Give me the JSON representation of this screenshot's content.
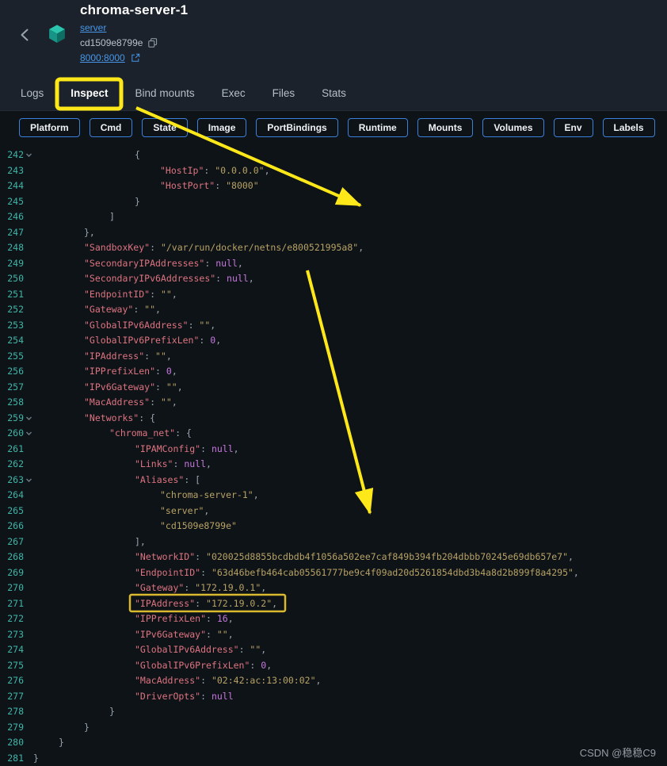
{
  "header": {
    "title": "chroma-server-1",
    "compose_link": "server",
    "container_id": "cd1509e8799e",
    "port_link": "8000:8000"
  },
  "tabs": {
    "items": [
      {
        "label": "Logs",
        "active": false
      },
      {
        "label": "Inspect",
        "active": true
      },
      {
        "label": "Bind mounts",
        "active": false
      },
      {
        "label": "Exec",
        "active": false
      },
      {
        "label": "Files",
        "active": false
      },
      {
        "label": "Stats",
        "active": false
      }
    ]
  },
  "section_chips": [
    "Platform",
    "Cmd",
    "State",
    "Image",
    "PortBindings",
    "Runtime",
    "Mounts",
    "Volumes",
    "Env",
    "Labels"
  ],
  "code": {
    "lines": [
      {
        "num": 242,
        "indent": 4,
        "fold": true,
        "tokens": [
          [
            "p",
            "{"
          ]
        ]
      },
      {
        "num": 243,
        "indent": 5,
        "fold": false,
        "tokens": [
          [
            "k",
            "\"HostIp\""
          ],
          [
            "p",
            ": "
          ],
          [
            "s",
            "\"0.0.0.0\""
          ],
          [
            "p",
            ","
          ]
        ]
      },
      {
        "num": 244,
        "indent": 5,
        "fold": false,
        "tokens": [
          [
            "k",
            "\"HostPort\""
          ],
          [
            "p",
            ": "
          ],
          [
            "s",
            "\"8000\""
          ]
        ]
      },
      {
        "num": 245,
        "indent": 4,
        "fold": false,
        "tokens": [
          [
            "p",
            "}"
          ]
        ]
      },
      {
        "num": 246,
        "indent": 3,
        "fold": false,
        "tokens": [
          [
            "p",
            "]"
          ]
        ]
      },
      {
        "num": 247,
        "indent": 2,
        "fold": false,
        "tokens": [
          [
            "p",
            "},"
          ]
        ]
      },
      {
        "num": 248,
        "indent": 2,
        "fold": false,
        "tokens": [
          [
            "k",
            "\"SandboxKey\""
          ],
          [
            "p",
            ": "
          ],
          [
            "s",
            "\"/var/run/docker/netns/e800521995a8\""
          ],
          [
            "p",
            ","
          ]
        ]
      },
      {
        "num": 249,
        "indent": 2,
        "fold": false,
        "tokens": [
          [
            "k",
            "\"SecondaryIPAddresses\""
          ],
          [
            "p",
            ": "
          ],
          [
            "n",
            "null"
          ],
          [
            "p",
            ","
          ]
        ]
      },
      {
        "num": 250,
        "indent": 2,
        "fold": false,
        "tokens": [
          [
            "k",
            "\"SecondaryIPv6Addresses\""
          ],
          [
            "p",
            ": "
          ],
          [
            "n",
            "null"
          ],
          [
            "p",
            ","
          ]
        ]
      },
      {
        "num": 251,
        "indent": 2,
        "fold": false,
        "tokens": [
          [
            "k",
            "\"EndpointID\""
          ],
          [
            "p",
            ": "
          ],
          [
            "s",
            "\"\""
          ],
          [
            "p",
            ","
          ]
        ]
      },
      {
        "num": 252,
        "indent": 2,
        "fold": false,
        "tokens": [
          [
            "k",
            "\"Gateway\""
          ],
          [
            "p",
            ": "
          ],
          [
            "s",
            "\"\""
          ],
          [
            "p",
            ","
          ]
        ]
      },
      {
        "num": 253,
        "indent": 2,
        "fold": false,
        "tokens": [
          [
            "k",
            "\"GlobalIPv6Address\""
          ],
          [
            "p",
            ": "
          ],
          [
            "s",
            "\"\""
          ],
          [
            "p",
            ","
          ]
        ]
      },
      {
        "num": 254,
        "indent": 2,
        "fold": false,
        "tokens": [
          [
            "k",
            "\"GlobalIPv6PrefixLen\""
          ],
          [
            "p",
            ": "
          ],
          [
            "n",
            "0"
          ],
          [
            "p",
            ","
          ]
        ]
      },
      {
        "num": 255,
        "indent": 2,
        "fold": false,
        "tokens": [
          [
            "k",
            "\"IPAddress\""
          ],
          [
            "p",
            ": "
          ],
          [
            "s",
            "\"\""
          ],
          [
            "p",
            ","
          ]
        ]
      },
      {
        "num": 256,
        "indent": 2,
        "fold": false,
        "tokens": [
          [
            "k",
            "\"IPPrefixLen\""
          ],
          [
            "p",
            ": "
          ],
          [
            "n",
            "0"
          ],
          [
            "p",
            ","
          ]
        ]
      },
      {
        "num": 257,
        "indent": 2,
        "fold": false,
        "tokens": [
          [
            "k",
            "\"IPv6Gateway\""
          ],
          [
            "p",
            ": "
          ],
          [
            "s",
            "\"\""
          ],
          [
            "p",
            ","
          ]
        ]
      },
      {
        "num": 258,
        "indent": 2,
        "fold": false,
        "tokens": [
          [
            "k",
            "\"MacAddress\""
          ],
          [
            "p",
            ": "
          ],
          [
            "s",
            "\"\""
          ],
          [
            "p",
            ","
          ]
        ]
      },
      {
        "num": 259,
        "indent": 2,
        "fold": true,
        "tokens": [
          [
            "k",
            "\"Networks\""
          ],
          [
            "p",
            ": {"
          ]
        ]
      },
      {
        "num": 260,
        "indent": 3,
        "fold": true,
        "tokens": [
          [
            "k",
            "\"chroma_net\""
          ],
          [
            "p",
            ": {"
          ]
        ]
      },
      {
        "num": 261,
        "indent": 4,
        "fold": false,
        "tokens": [
          [
            "k",
            "\"IPAMConfig\""
          ],
          [
            "p",
            ": "
          ],
          [
            "n",
            "null"
          ],
          [
            "p",
            ","
          ]
        ]
      },
      {
        "num": 262,
        "indent": 4,
        "fold": false,
        "tokens": [
          [
            "k",
            "\"Links\""
          ],
          [
            "p",
            ": "
          ],
          [
            "n",
            "null"
          ],
          [
            "p",
            ","
          ]
        ]
      },
      {
        "num": 263,
        "indent": 4,
        "fold": true,
        "tokens": [
          [
            "k",
            "\"Aliases\""
          ],
          [
            "p",
            ": ["
          ]
        ]
      },
      {
        "num": 264,
        "indent": 5,
        "fold": false,
        "tokens": [
          [
            "s",
            "\"chroma-server-1\""
          ],
          [
            "p",
            ","
          ]
        ]
      },
      {
        "num": 265,
        "indent": 5,
        "fold": false,
        "tokens": [
          [
            "s",
            "\"server\""
          ],
          [
            "p",
            ","
          ]
        ]
      },
      {
        "num": 266,
        "indent": 5,
        "fold": false,
        "tokens": [
          [
            "s",
            "\"cd1509e8799e\""
          ]
        ]
      },
      {
        "num": 267,
        "indent": 4,
        "fold": false,
        "tokens": [
          [
            "p",
            "],"
          ]
        ]
      },
      {
        "num": 268,
        "indent": 4,
        "fold": false,
        "tokens": [
          [
            "k",
            "\"NetworkID\""
          ],
          [
            "p",
            ": "
          ],
          [
            "s",
            "\"020025d8855bcdbdb4f1056a502ee7caf849b394fb204dbbb70245e69db657e7\""
          ],
          [
            "p",
            ","
          ]
        ]
      },
      {
        "num": 269,
        "indent": 4,
        "fold": false,
        "tokens": [
          [
            "k",
            "\"EndpointID\""
          ],
          [
            "p",
            ": "
          ],
          [
            "s",
            "\"63d46befb464cab05561777be9c4f09ad20d5261854dbd3b4a8d2b899f8a4295\""
          ],
          [
            "p",
            ","
          ]
        ]
      },
      {
        "num": 270,
        "indent": 4,
        "fold": false,
        "tokens": [
          [
            "k",
            "\"Gateway\""
          ],
          [
            "p",
            ": "
          ],
          [
            "s",
            "\"172.19.0.1\""
          ],
          [
            "p",
            ","
          ]
        ]
      },
      {
        "num": 271,
        "indent": 4,
        "fold": false,
        "highlight": true,
        "tokens": [
          [
            "k",
            "\"IPAddress\""
          ],
          [
            "p",
            ": "
          ],
          [
            "s",
            "\"172.19.0.2\""
          ],
          [
            "p",
            ","
          ]
        ]
      },
      {
        "num": 272,
        "indent": 4,
        "fold": false,
        "tokens": [
          [
            "k",
            "\"IPPrefixLen\""
          ],
          [
            "p",
            ": "
          ],
          [
            "n",
            "16"
          ],
          [
            "p",
            ","
          ]
        ]
      },
      {
        "num": 273,
        "indent": 4,
        "fold": false,
        "tokens": [
          [
            "k",
            "\"IPv6Gateway\""
          ],
          [
            "p",
            ": "
          ],
          [
            "s",
            "\"\""
          ],
          [
            "p",
            ","
          ]
        ]
      },
      {
        "num": 274,
        "indent": 4,
        "fold": false,
        "tokens": [
          [
            "k",
            "\"GlobalIPv6Address\""
          ],
          [
            "p",
            ": "
          ],
          [
            "s",
            "\"\""
          ],
          [
            "p",
            ","
          ]
        ]
      },
      {
        "num": 275,
        "indent": 4,
        "fold": false,
        "tokens": [
          [
            "k",
            "\"GlobalIPv6PrefixLen\""
          ],
          [
            "p",
            ": "
          ],
          [
            "n",
            "0"
          ],
          [
            "p",
            ","
          ]
        ]
      },
      {
        "num": 276,
        "indent": 4,
        "fold": false,
        "tokens": [
          [
            "k",
            "\"MacAddress\""
          ],
          [
            "p",
            ": "
          ],
          [
            "s",
            "\"02:42:ac:13:00:02\""
          ],
          [
            "p",
            ","
          ]
        ]
      },
      {
        "num": 277,
        "indent": 4,
        "fold": false,
        "tokens": [
          [
            "k",
            "\"DriverOpts\""
          ],
          [
            "p",
            ": "
          ],
          [
            "n",
            "null"
          ]
        ]
      },
      {
        "num": 278,
        "indent": 3,
        "fold": false,
        "tokens": [
          [
            "p",
            "}"
          ]
        ]
      },
      {
        "num": 279,
        "indent": 2,
        "fold": false,
        "tokens": [
          [
            "p",
            "}"
          ]
        ]
      },
      {
        "num": 280,
        "indent": 1,
        "fold": false,
        "tokens": [
          [
            "p",
            "}"
          ]
        ]
      },
      {
        "num": 281,
        "indent": 0,
        "fold": false,
        "tokens": [
          [
            "p",
            "}"
          ]
        ]
      }
    ]
  },
  "watermark": "CSDN @稳稳C9",
  "colors": {
    "header_bg": "#1b222b",
    "page_bg": "#0e1318",
    "accent_blue": "#2e7cd6",
    "chip_border_blue": "#3a7fd9",
    "link_blue": "#4796e8",
    "line_number_teal": "#3fb5a8",
    "json_key": "#de7480",
    "json_string": "#b8a265",
    "json_literal": "#c678dd",
    "annotation_yellow": "#ffe81a",
    "highlight_gold": "#d9b92e",
    "container_icon_teal": "#2bc4ad"
  }
}
